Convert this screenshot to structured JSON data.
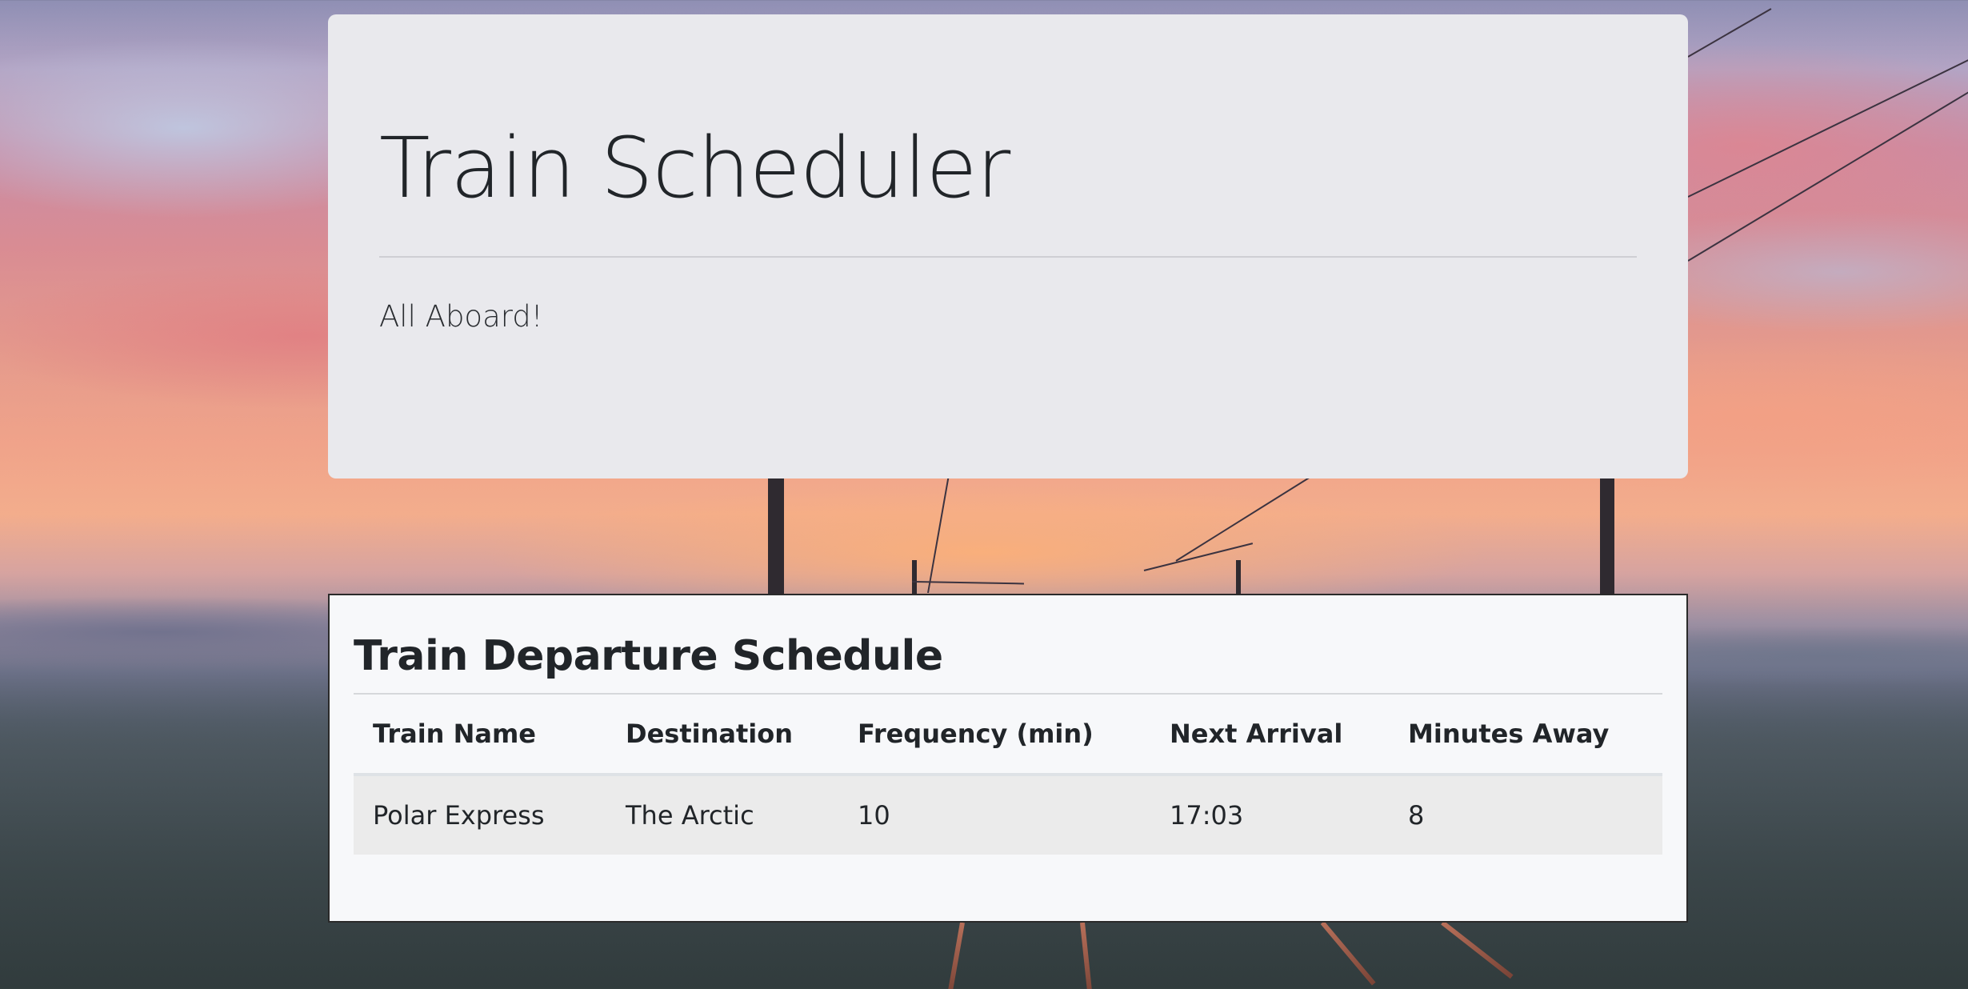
{
  "header": {
    "title": "Train Scheduler",
    "tagline": "All Aboard!"
  },
  "schedule": {
    "title": "Train Departure Schedule",
    "columns": [
      "Train Name",
      "Destination",
      "Frequency (min)",
      "Next Arrival",
      "Minutes Away"
    ],
    "rows": [
      [
        "Polar Express",
        "The Arctic",
        "10",
        "17:03",
        "8"
      ]
    ]
  },
  "colors": {
    "panel": "#e9e9ed",
    "table_panel": "#f7f8fa",
    "row_stripe": "#ebebeb",
    "text": "#212529"
  }
}
